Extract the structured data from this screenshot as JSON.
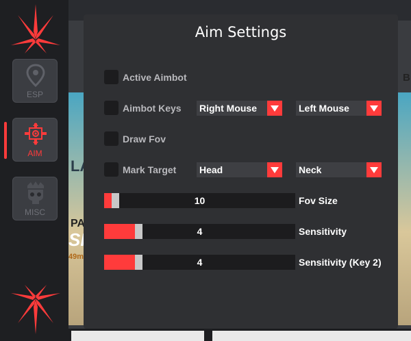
{
  "panel": {
    "title": "Aim Settings"
  },
  "sidebar": {
    "items": [
      {
        "label": "ESP",
        "icon": "map-pin-icon",
        "active": false
      },
      {
        "label": "AIM",
        "icon": "crosshair-icon",
        "active": true
      },
      {
        "label": "MISC",
        "icon": "skull-icon",
        "active": false
      }
    ]
  },
  "options": {
    "active_aimbot": {
      "label": "Active Aimbot",
      "checked": false
    },
    "aimbot_keys": {
      "label": "Aimbot Keys",
      "checked": false,
      "key1": "Right Mouse",
      "key2": "Left Mouse"
    },
    "draw_fov": {
      "label": "Draw Fov",
      "checked": false
    },
    "mark_target": {
      "label": "Mark Target",
      "checked": false,
      "target1": "Head",
      "target2": "Neck"
    }
  },
  "sliders": [
    {
      "label": "Fov Size",
      "value": "10",
      "fraction": 0.04
    },
    {
      "label": "Sensitivity",
      "value": "4",
      "fraction": 0.16
    },
    {
      "label": "Sensitivity (Key 2)",
      "value": "4",
      "fraction": 0.16
    }
  ],
  "background": {
    "letter_b": "B",
    "scene_text_1": "LA",
    "scene_text_2": "PAS",
    "scene_text_3": "SI",
    "scene_text_4": "49m"
  },
  "colors": {
    "accent": "#ff3b3b",
    "panel": "#2f3033",
    "sidebar": "#1e1f22"
  }
}
